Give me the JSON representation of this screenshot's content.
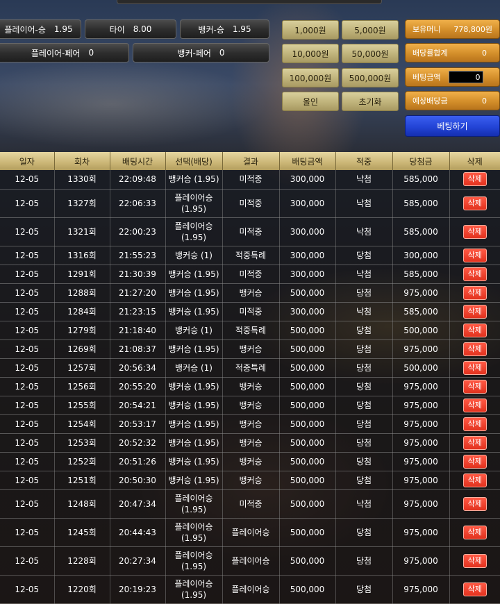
{
  "bets": {
    "player_win": {
      "label": "플레이어-승",
      "odds": "1.95"
    },
    "tie": {
      "label": "타이",
      "odds": "8.00"
    },
    "banker_win": {
      "label": "뱅커-승",
      "odds": "1.95"
    },
    "player_pair": {
      "label": "플레이어-페어",
      "odds": "0"
    },
    "banker_pair": {
      "label": "뱅커-페어",
      "odds": "0"
    }
  },
  "chips": [
    "1,000원",
    "5,000원",
    "10,000원",
    "50,000원",
    "100,000원",
    "500,000원",
    "올인",
    "초기화"
  ],
  "panel": {
    "balance_label": "보유머니",
    "balance_value": "778,800원",
    "odds_sum_label": "배당률합계",
    "odds_sum_value": "0",
    "bet_amount_label": "베팅금액",
    "bet_amount_value": "0",
    "expected_label": "예상배당금",
    "expected_value": "0",
    "bet_button": "베팅하기"
  },
  "table": {
    "headers": [
      "일자",
      "회차",
      "배팅시간",
      "선택(배당)",
      "결과",
      "배팅금액",
      "적중",
      "당첨금",
      "삭제"
    ],
    "rows": [
      {
        "date": "12-05",
        "round": "1330회",
        "time": "22:09:48",
        "sel1": "뱅커승 (1.95)",
        "sel2": "",
        "result": "미적중",
        "amount": "300,000",
        "hit": "낙첨",
        "hit_type": "lose",
        "payout": "585,000",
        "del": "삭제"
      },
      {
        "date": "12-05",
        "round": "1327회",
        "time": "22:06:33",
        "sel1": "플레이어승",
        "sel2": "(1.95)",
        "result": "미적중",
        "amount": "300,000",
        "hit": "낙첨",
        "hit_type": "lose",
        "payout": "585,000",
        "del": "삭제"
      },
      {
        "date": "12-05",
        "round": "1321회",
        "time": "22:00:23",
        "sel1": "플레이어승",
        "sel2": "(1.95)",
        "result": "미적중",
        "amount": "300,000",
        "hit": "낙첨",
        "hit_type": "lose",
        "payout": "585,000",
        "del": "삭제"
      },
      {
        "date": "12-05",
        "round": "1316회",
        "time": "21:55:23",
        "sel1": "뱅커승 (1)",
        "sel2": "",
        "result": "적중특례",
        "amount": "300,000",
        "hit": "당첨",
        "hit_type": "win",
        "payout": "300,000",
        "del": "삭제"
      },
      {
        "date": "12-05",
        "round": "1291회",
        "time": "21:30:39",
        "sel1": "뱅커승 (1.95)",
        "sel2": "",
        "result": "미적중",
        "amount": "300,000",
        "hit": "낙첨",
        "hit_type": "lose",
        "payout": "585,000",
        "del": "삭제"
      },
      {
        "date": "12-05",
        "round": "1288회",
        "time": "21:27:20",
        "sel1": "뱅커승 (1.95)",
        "sel2": "",
        "result": "뱅커승",
        "amount": "500,000",
        "hit": "당첨",
        "hit_type": "win",
        "payout": "975,000",
        "del": "삭제"
      },
      {
        "date": "12-05",
        "round": "1284회",
        "time": "21:23:15",
        "sel1": "뱅커승 (1.95)",
        "sel2": "",
        "result": "미적중",
        "amount": "300,000",
        "hit": "낙첨",
        "hit_type": "lose",
        "payout": "585,000",
        "del": "삭제"
      },
      {
        "date": "12-05",
        "round": "1279회",
        "time": "21:18:40",
        "sel1": "뱅커승 (1)",
        "sel2": "",
        "result": "적중특례",
        "amount": "500,000",
        "hit": "당첨",
        "hit_type": "win",
        "payout": "500,000",
        "del": "삭제"
      },
      {
        "date": "12-05",
        "round": "1269회",
        "time": "21:08:37",
        "sel1": "뱅커승 (1.95)",
        "sel2": "",
        "result": "뱅커승",
        "amount": "500,000",
        "hit": "당첨",
        "hit_type": "win",
        "payout": "975,000",
        "del": "삭제"
      },
      {
        "date": "12-05",
        "round": "1257회",
        "time": "20:56:34",
        "sel1": "뱅커승 (1)",
        "sel2": "",
        "result": "적중특례",
        "amount": "500,000",
        "hit": "당첨",
        "hit_type": "win",
        "payout": "500,000",
        "del": "삭제"
      },
      {
        "date": "12-05",
        "round": "1256회",
        "time": "20:55:20",
        "sel1": "뱅커승 (1.95)",
        "sel2": "",
        "result": "뱅커승",
        "amount": "500,000",
        "hit": "당첨",
        "hit_type": "win",
        "payout": "975,000",
        "del": "삭제"
      },
      {
        "date": "12-05",
        "round": "1255회",
        "time": "20:54:21",
        "sel1": "뱅커승 (1.95)",
        "sel2": "",
        "result": "뱅커승",
        "amount": "500,000",
        "hit": "당첨",
        "hit_type": "win",
        "payout": "975,000",
        "del": "삭제"
      },
      {
        "date": "12-05",
        "round": "1254회",
        "time": "20:53:17",
        "sel1": "뱅커승 (1.95)",
        "sel2": "",
        "result": "뱅커승",
        "amount": "500,000",
        "hit": "당첨",
        "hit_type": "win",
        "payout": "975,000",
        "del": "삭제"
      },
      {
        "date": "12-05",
        "round": "1253회",
        "time": "20:52:32",
        "sel1": "뱅커승 (1.95)",
        "sel2": "",
        "result": "뱅커승",
        "amount": "500,000",
        "hit": "당첨",
        "hit_type": "win",
        "payout": "975,000",
        "del": "삭제"
      },
      {
        "date": "12-05",
        "round": "1252회",
        "time": "20:51:26",
        "sel1": "뱅커승 (1.95)",
        "sel2": "",
        "result": "뱅커승",
        "amount": "500,000",
        "hit": "당첨",
        "hit_type": "win",
        "payout": "975,000",
        "del": "삭제"
      },
      {
        "date": "12-05",
        "round": "1251회",
        "time": "20:50:30",
        "sel1": "뱅커승 (1.95)",
        "sel2": "",
        "result": "뱅커승",
        "amount": "500,000",
        "hit": "당첨",
        "hit_type": "win",
        "payout": "975,000",
        "del": "삭제"
      },
      {
        "date": "12-05",
        "round": "1248회",
        "time": "20:47:34",
        "sel1": "플레이어승",
        "sel2": "(1.95)",
        "result": "미적중",
        "amount": "500,000",
        "hit": "낙첨",
        "hit_type": "lose",
        "payout": "975,000",
        "del": "삭제"
      },
      {
        "date": "12-05",
        "round": "1245회",
        "time": "20:44:43",
        "sel1": "플레이어승",
        "sel2": "(1.95)",
        "result": "플레이어승",
        "amount": "500,000",
        "hit": "당첨",
        "hit_type": "win",
        "payout": "975,000",
        "del": "삭제"
      },
      {
        "date": "12-05",
        "round": "1228회",
        "time": "20:27:34",
        "sel1": "플레이어승",
        "sel2": "(1.95)",
        "result": "플레이어승",
        "amount": "500,000",
        "hit": "당첨",
        "hit_type": "win",
        "payout": "975,000",
        "del": "삭제"
      },
      {
        "date": "12-05",
        "round": "1220회",
        "time": "20:19:23",
        "sel1": "플레이어승",
        "sel2": "(1.95)",
        "result": "플레이어승",
        "amount": "500,000",
        "hit": "당첨",
        "hit_type": "win",
        "payout": "975,000",
        "del": "삭제"
      }
    ]
  },
  "colors": {
    "lose": "#ff2a2a",
    "win": "#3a5cff",
    "accent": "#d38e2a",
    "bet_button": "#2344d6"
  }
}
